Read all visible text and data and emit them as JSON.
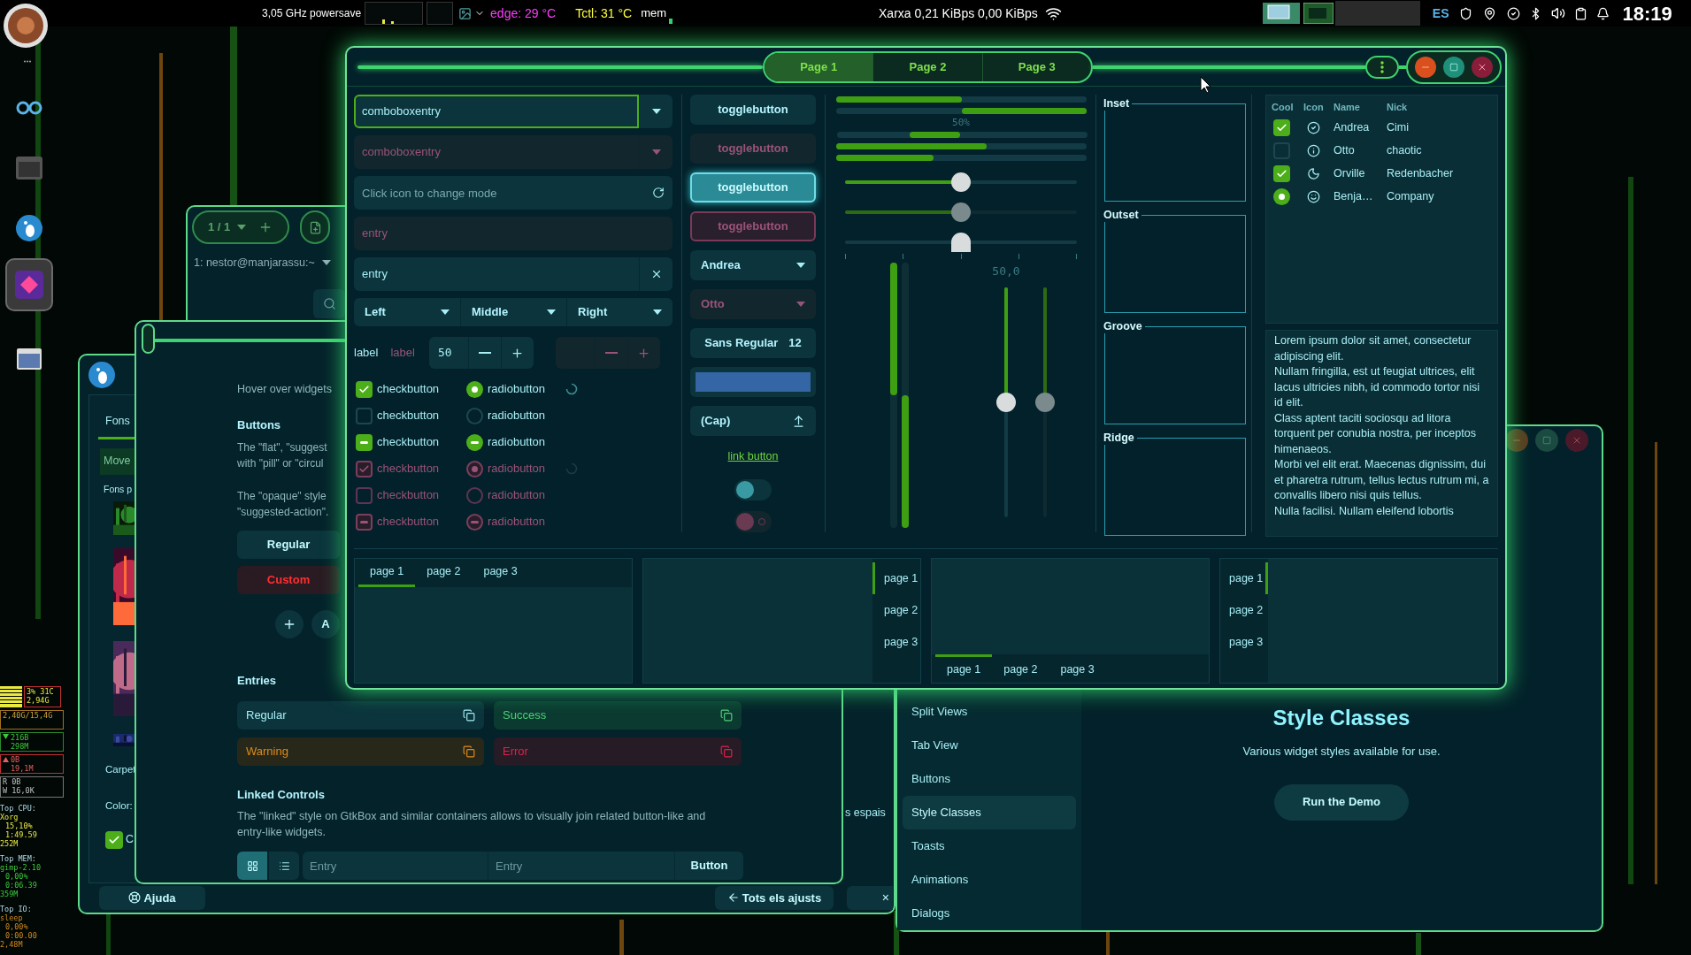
{
  "top_bar": {
    "cpu": "3,05 GHz powersave",
    "edge": "edge: 29 °C",
    "tctl": "Tctl: 31 °C",
    "mem": "mem",
    "network": "Xarxa 0,21 KiBps 0,00 KiBps",
    "layout": "ES",
    "clock": "18:19"
  },
  "dock": [
    {
      "selected": false
    },
    {
      "selected": false
    },
    {
      "selected": false
    },
    {
      "selected": true
    },
    {
      "selected": false
    }
  ],
  "conky": {
    "cpu": [
      "3% 31C",
      "2,94G"
    ],
    "ram": "2,40G/15,4G",
    "down": [
      "216B",
      "298M"
    ],
    "up": [
      "0B",
      "19,1M"
    ],
    "disk": [
      "R 0B",
      "W 16,0K"
    ],
    "tops": [
      {
        "title": "Top CPU:",
        "lines": [
          "Xorg",
          "15,10%",
          "1:49.59",
          "252M"
        ]
      },
      {
        "title": "Top MEM:",
        "lines": [
          "gimp-2.10",
          "0,00%",
          "0:06.39",
          "359M"
        ]
      },
      {
        "title": "Top IO:",
        "lines": [
          "sleep",
          "0,00%",
          "0:00.00",
          "2,48M"
        ]
      }
    ]
  },
  "terminal": {
    "counter": "1 / 1",
    "tab": "1: nestor@manjarassu:~"
  },
  "settings": {
    "tab": {
      "label": "Fons",
      "selected": true
    },
    "move": "Move",
    "section": "Fons p",
    "folder": "Carpet",
    "color_label": "Color:",
    "check": {
      "label": "C",
      "checked": true
    },
    "partial": "s espais",
    "help": "Ajuda",
    "back": "Tots els ajusts",
    "close": "×"
  },
  "demo_left": {
    "hover": "Hover over widgets",
    "buttons_title": "Buttons",
    "buttons_desc": [
      "The \"flat\", \"suggest",
      "with \"pill\" or \"circul"
    ],
    "opaque_desc": [
      "The \"opaque\" style",
      "\"suggested-action\"."
    ],
    "buttons": [
      {
        "label": "Regular",
        "kind": "regular"
      },
      {
        "label": "Custom",
        "kind": "custom"
      }
    ],
    "round_label": "A",
    "entries_title": "Entries",
    "entries": [
      {
        "value": "Regular",
        "kind": "regular"
      },
      {
        "value": "Success",
        "kind": "success"
      },
      {
        "value": "Warning",
        "kind": "warning"
      },
      {
        "value": "Error",
        "kind": "error"
      }
    ],
    "linked_title": "Linked Controls",
    "linked_desc": "The \"linked\" style on GtkBox and similar containers allows to visually join related button-like and entry-like widgets.",
    "view_toggles": [
      {
        "selected": true
      },
      {
        "selected": false
      }
    ],
    "linked_entries": [
      {
        "placeholder": "Entry"
      },
      {
        "placeholder": "Entry"
      }
    ],
    "linked_button": "Button"
  },
  "demo_right": {
    "sidebar": [
      {
        "label": "Split Views",
        "selected": false
      },
      {
        "label": "Tab View",
        "selected": false
      },
      {
        "label": "Buttons",
        "selected": false
      },
      {
        "label": "Style Classes",
        "selected": true
      },
      {
        "label": "Toasts",
        "selected": false
      },
      {
        "label": "Animations",
        "selected": false
      },
      {
        "label": "Dialogs",
        "selected": false
      }
    ],
    "title": "Style Classes",
    "description": "Various widget styles available for use.",
    "button": "Run the Demo"
  },
  "main": {
    "tabs": [
      {
        "label": "Page 1",
        "selected": true
      },
      {
        "label": "Page 2",
        "selected": false
      },
      {
        "label": "Page 3",
        "selected": false
      }
    ],
    "combos": [
      {
        "value": "comboboxentry",
        "disabled": false,
        "focused": true
      },
      {
        "value": "comboboxentry",
        "disabled": true,
        "focused": false
      }
    ],
    "mode_entry": {
      "placeholder": "Click icon to change mode"
    },
    "entries": [
      {
        "value": "entry",
        "disabled": true
      },
      {
        "value": "entry",
        "disabled": false
      }
    ],
    "dropdowns": [
      "Left",
      "Middle",
      "Right"
    ],
    "labels": [
      {
        "text": "label",
        "disabled": false
      },
      {
        "text": "label",
        "disabled": true
      }
    ],
    "spins": [
      {
        "value": "50",
        "disabled": false
      },
      {
        "disabled": true
      }
    ],
    "check_rows": [
      {
        "check": {
          "label": "checkbutton",
          "checked": true,
          "inconsistent": false,
          "disabled": false
        },
        "radio": {
          "label": "radiobutton",
          "checked": true,
          "inconsistent": false,
          "disabled": false
        },
        "spinner": {
          "disabled": false
        }
      },
      {
        "check": {
          "label": "checkbutton",
          "checked": false,
          "inconsistent": false,
          "disabled": false
        },
        "radio": {
          "label": "radiobutton",
          "checked": false,
          "inconsistent": false,
          "disabled": false
        }
      },
      {
        "check": {
          "label": "checkbutton",
          "checked": true,
          "inconsistent": true,
          "disabled": false
        },
        "radio": {
          "label": "radiobutton",
          "checked": true,
          "inconsistent": true,
          "disabled": false
        }
      },
      {
        "check": {
          "label": "checkbutton",
          "checked": true,
          "inconsistent": false,
          "disabled": true
        },
        "radio": {
          "label": "radiobutton",
          "checked": true,
          "inconsistent": false,
          "disabled": true
        },
        "spinner": {
          "disabled": true
        }
      },
      {
        "check": {
          "label": "checkbutton",
          "checked": false,
          "inconsistent": false,
          "disabled": true
        },
        "radio": {
          "label": "radiobutton",
          "checked": false,
          "inconsistent": false,
          "disabled": true
        }
      },
      {
        "check": {
          "label": "checkbutton",
          "checked": true,
          "inconsistent": true,
          "disabled": true
        },
        "radio": {
          "label": "radiobutton",
          "checked": true,
          "inconsistent": true,
          "disabled": true
        }
      }
    ],
    "toggles": [
      {
        "label": "togglebutton",
        "active": false,
        "disabled": false
      },
      {
        "label": "togglebutton",
        "active": false,
        "disabled": true
      },
      {
        "label": "togglebutton",
        "active": true,
        "disabled": false
      },
      {
        "label": "togglebutton",
        "active": true,
        "disabled": true
      }
    ],
    "combo_buttons": [
      {
        "label": "Andrea",
        "disabled": false
      },
      {
        "label": "Otto",
        "disabled": true
      }
    ],
    "font_button": {
      "name": "Sans Regular",
      "size": "12"
    },
    "file_button": {
      "label": "(Cap)"
    },
    "link": "link button",
    "switches": [
      {
        "on": false,
        "disabled": false
      },
      {
        "on": false,
        "disabled": true
      }
    ],
    "progress": [
      {
        "kind": "bar",
        "level": 0.5
      },
      {
        "kind": "inverted",
        "level": 0.5
      },
      {
        "kind": "pulse",
        "text": "50%"
      },
      {
        "kind": "bar",
        "level": 0.6
      },
      {
        "kind": "bar",
        "level": 0.39
      }
    ],
    "hscales": [
      {
        "level": 0.5,
        "disabled": false,
        "highlight": true,
        "marks": false
      },
      {
        "level": 0.5,
        "disabled": true,
        "highlight": true,
        "marks": false
      },
      {
        "level": 0.5,
        "disabled": false,
        "highlight": false,
        "marks": true
      }
    ],
    "vbars": [
      {
        "level": 0.5,
        "from_top": true
      },
      {
        "level": 0.5,
        "from_top": false
      }
    ],
    "scale_value": "50,0",
    "vscales": [
      {
        "level": 0.5,
        "disabled": false
      },
      {
        "level": 0.5,
        "disabled": true
      }
    ],
    "frames": [
      "Inset",
      "Outset",
      "Groove",
      "Ridge"
    ],
    "tree": {
      "columns": [
        "Cool",
        "Icon",
        "Name",
        "Nick"
      ],
      "rows": [
        {
          "cool": {
            "checked": true,
            "kind": "check"
          },
          "name": "Andrea",
          "nick": "Cimi"
        },
        {
          "cool": {
            "checked": false,
            "kind": "check"
          },
          "name": "Otto",
          "nick": "chaotic"
        },
        {
          "cool": {
            "checked": true,
            "kind": "check"
          },
          "name": "Orville",
          "nick": "Redenbacher"
        },
        {
          "cool": {
            "checked": true,
            "kind": "radio"
          },
          "name": "Benja…",
          "nick": "Company"
        }
      ]
    },
    "text_view": [
      "Lorem ipsum dolor sit amet, consectetur adipiscing elit.",
      "Nullam fringilla, est ut feugiat ultrices, elit lacus ultricies nibh, id commodo tortor nisi id elit.",
      "Class aptent taciti sociosqu ad litora torquent per conubia nostra, per inceptos himenaeos.",
      "Morbi vel elit erat. Maecenas dignissim, dui et pharetra rutrum, tellus lectus rutrum mi, a convallis libero nisi quis tellus.",
      "Nulla facilisi. Nullam eleifend lobortis"
    ],
    "notebooks": [
      {
        "kind": "top",
        "tabs": [
          {
            "label": "page 1",
            "selected": true
          },
          {
            "label": "page 2",
            "selected": false
          },
          {
            "label": "page 3",
            "selected": false
          }
        ]
      },
      {
        "kind": "right",
        "tabs": [
          {
            "label": "page 1",
            "selected": true
          },
          {
            "label": "page 2",
            "selected": false
          },
          {
            "label": "page 3",
            "selected": false
          }
        ]
      },
      {
        "kind": "bottom",
        "tabs": [
          {
            "label": "page 1",
            "selected": true
          },
          {
            "label": "page 2",
            "selected": false
          },
          {
            "label": "page 3",
            "selected": false
          }
        ]
      },
      {
        "kind": "left",
        "tabs": [
          {
            "label": "page 1",
            "selected": true
          },
          {
            "label": "page 2",
            "selected": false
          },
          {
            "label": "page 3",
            "selected": false
          }
        ]
      }
    ]
  }
}
